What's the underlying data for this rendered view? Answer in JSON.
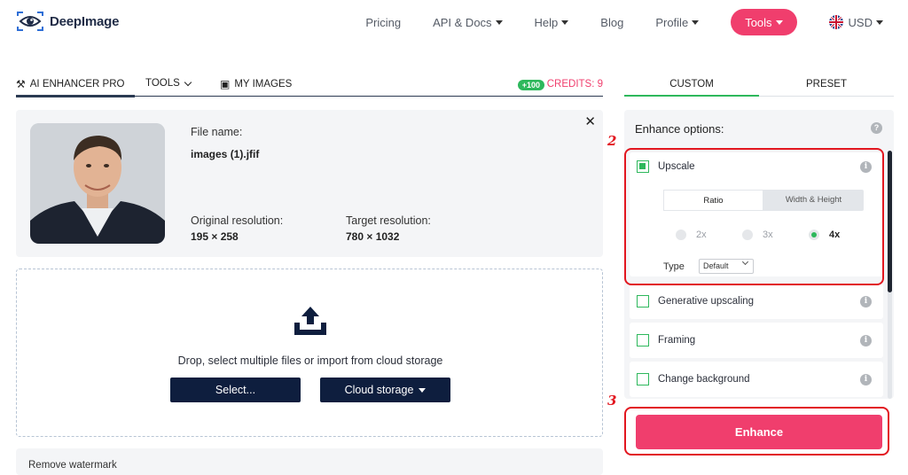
{
  "brand": {
    "name": "DeepImage"
  },
  "nav": {
    "items": [
      {
        "label": "Pricing",
        "dropdown": false
      },
      {
        "label": "API & Docs",
        "dropdown": true
      },
      {
        "label": "Help",
        "dropdown": true
      },
      {
        "label": "Blog",
        "dropdown": false
      },
      {
        "label": "Profile",
        "dropdown": true
      }
    ],
    "tools_label": "Tools",
    "currency_label": "USD"
  },
  "tabs": {
    "enhancer": "AI ENHANCER PRO",
    "tools": "TOOLS",
    "images": "MY IMAGES",
    "credit_badge": "+100",
    "credits": "CREDITS: 9"
  },
  "file": {
    "name_label": "File name:",
    "name_value": "images (1).jfif",
    "orig_label": "Original resolution:",
    "orig_value": "195 × 258",
    "target_label": "Target resolution:",
    "target_value": "780 × 1032"
  },
  "upload": {
    "prompt": "Drop, select multiple files or import from cloud storage",
    "select_label": "Select...",
    "cloud_label": "Cloud storage"
  },
  "watermark": {
    "label": "Remove watermark"
  },
  "right": {
    "tabs": [
      "CUSTOM",
      "PRESET"
    ],
    "title": "Enhance options:",
    "upscale": {
      "label": "Upscale",
      "checked": true,
      "modes": [
        "Ratio",
        "Width & Height"
      ],
      "ratios": [
        "2x",
        "3x",
        "4x"
      ],
      "selected_ratio": "4x",
      "type_label": "Type",
      "type_value": "Default"
    },
    "options": [
      {
        "label": "Generative upscaling",
        "checked": false
      },
      {
        "label": "Framing",
        "checked": false
      },
      {
        "label": "Change background",
        "checked": false
      }
    ],
    "enhance_label": "Enhance"
  },
  "annotations": {
    "step2": "2",
    "step3": "3"
  },
  "colors": {
    "accent": "#f03e6d",
    "green": "#2eb85c",
    "navy": "#0e1e3e",
    "callout": "#e2161f"
  }
}
